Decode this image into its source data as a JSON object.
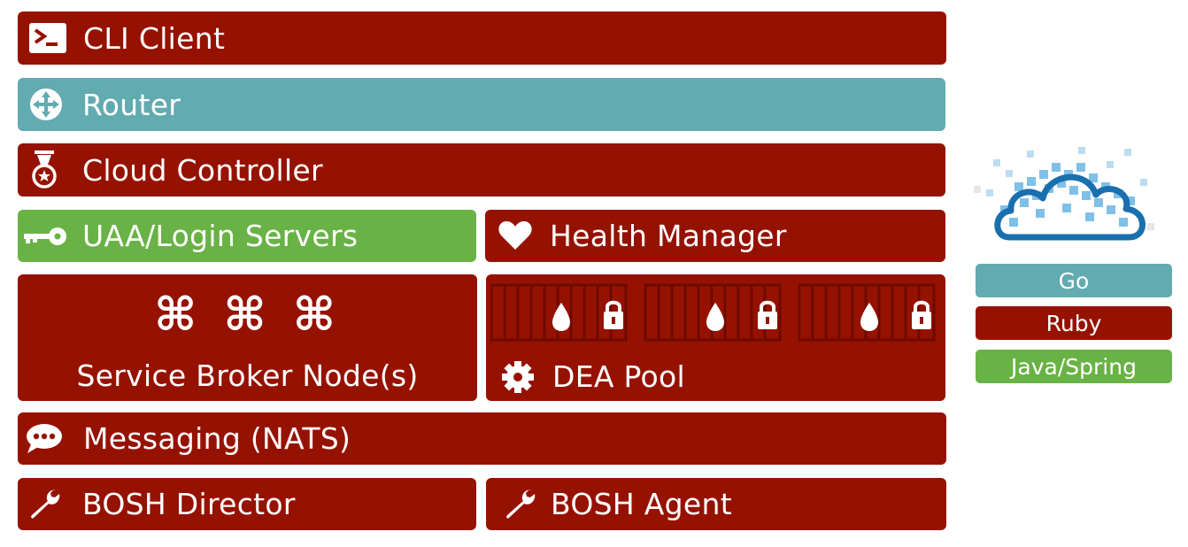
{
  "components": {
    "cli": "CLI Client",
    "router": "Router",
    "cloud_controller": "Cloud Controller",
    "uaa": "UAA/Login Servers",
    "health": "Health Manager",
    "service_broker": "Service Broker Node(s)",
    "service_broker_symbols": "⌘ ⌘ ⌘",
    "dea_pool": "DEA Pool",
    "messaging": "Messaging (NATS)",
    "bosh_director": "BOSH Director",
    "bosh_agent": "BOSH Agent"
  },
  "legend": [
    {
      "label": "Go",
      "color": "#62abb0"
    },
    {
      "label": "Ruby",
      "color": "#961200"
    },
    {
      "label": "Java/Spring",
      "color": "#69b245"
    }
  ],
  "colors": {
    "ruby": "#961200",
    "go": "#62abb0",
    "java": "#69b245"
  },
  "icons": {
    "cli": "terminal-icon",
    "router": "router-icon",
    "cloud_controller": "medal-icon",
    "uaa": "key-icon",
    "health": "heart-icon",
    "dea_pool": "gear-icon",
    "dea_containers": "container-icon",
    "messaging": "chat-bubble-icon",
    "bosh": "wrench-icon",
    "logo": "cloud-logo-icon"
  }
}
